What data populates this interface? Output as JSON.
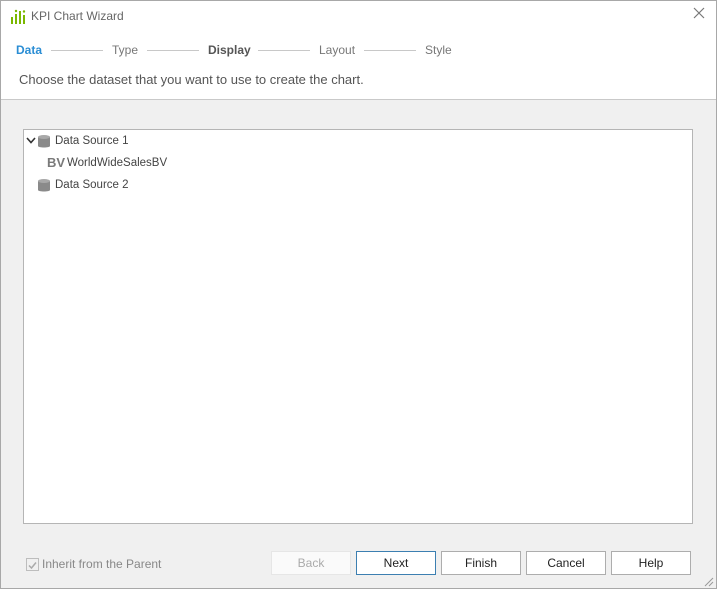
{
  "window": {
    "title": "KPI Chart Wizard"
  },
  "steps": [
    {
      "label": "Data"
    },
    {
      "label": "Type"
    },
    {
      "label": "Display"
    },
    {
      "label": "Layout"
    },
    {
      "label": "Style"
    }
  ],
  "instruction": "Choose the dataset that you want to use to create the chart.",
  "tree": {
    "items": [
      {
        "label": "Data Source 1",
        "expanded": true,
        "icon": "database-icon"
      },
      {
        "label": "WorldWideSalesBV",
        "icon": "business-view-icon",
        "icon_text": "BV"
      },
      {
        "label": "Data Source 2",
        "expanded": false,
        "icon": "database-icon"
      }
    ]
  },
  "footer": {
    "inherit_label": "Inherit from the Parent",
    "inherit_checked": true,
    "buttons": {
      "back": "Back",
      "next": "Next",
      "finish": "Finish",
      "cancel": "Cancel",
      "help": "Help"
    }
  },
  "colors": {
    "accent": "#2a8dd4",
    "icon_green": "#7ab800"
  }
}
